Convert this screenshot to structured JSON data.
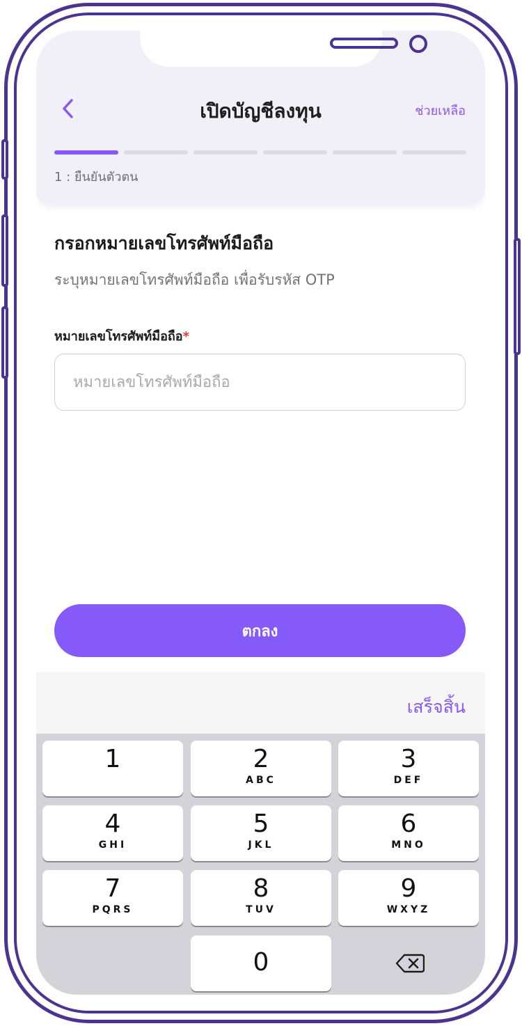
{
  "header": {
    "title": "เปิดบัญชีลงทุน",
    "help_label": "ช่วยเหลือ",
    "step_label": "1 : ยืนยันตัวตน",
    "progress": {
      "current_step": 1,
      "total_steps": 6
    }
  },
  "form": {
    "title": "กรอกหมายเลขโทรศัพท์มือถือ",
    "subtitle": "ระบุหมายเลขโทรศัพท์มือถือ เพื่อรับรหัส OTP",
    "phone_label": "หมายเลขโทรศัพท์มือถือ",
    "required_mark": "*",
    "phone_placeholder": "หมายเลขโทรศัพท์มือถือ",
    "phone_value": ""
  },
  "actions": {
    "ok_label": "ตกลง"
  },
  "keyboard": {
    "done_label": "เสร็จสิ้น",
    "keys": [
      {
        "num": "1",
        "letters": ""
      },
      {
        "num": "2",
        "letters": "ABC"
      },
      {
        "num": "3",
        "letters": "DEF"
      },
      {
        "num": "4",
        "letters": "GHI"
      },
      {
        "num": "5",
        "letters": "JKL"
      },
      {
        "num": "6",
        "letters": "MNO"
      },
      {
        "num": "7",
        "letters": "PQRS"
      },
      {
        "num": "8",
        "letters": "TUV"
      },
      {
        "num": "9",
        "letters": "WXYZ"
      }
    ],
    "zero": {
      "num": "0"
    }
  },
  "colors": {
    "accent": "#8659f4",
    "frame": "#4b3491",
    "header_bg": "#f1eff8",
    "keyboard_bg": "#d3d3d9",
    "required": "#e0373c"
  },
  "icons": {
    "back": "chevron-left-icon",
    "delete": "backspace-icon"
  }
}
